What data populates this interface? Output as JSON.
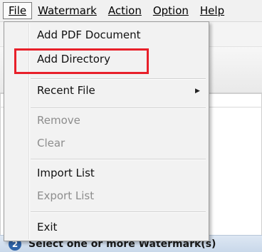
{
  "menubar": {
    "items": [
      {
        "label": "File"
      },
      {
        "label": "Watermark"
      },
      {
        "label": "Action"
      },
      {
        "label": "Option"
      },
      {
        "label": "Help"
      }
    ]
  },
  "file_menu": {
    "add_pdf": "Add PDF Document",
    "add_directory": "Add Directory",
    "recent_file": "Recent File",
    "remove": "Remove",
    "clear": "Clear",
    "import_list": "Import List",
    "export_list": "Export List",
    "exit": "Exit"
  },
  "step_bar": {
    "number": "2",
    "label": "Select one or more Watermark(s)"
  },
  "colors": {
    "highlight_border": "#e8202a",
    "step_badge": "#2f63a8"
  }
}
